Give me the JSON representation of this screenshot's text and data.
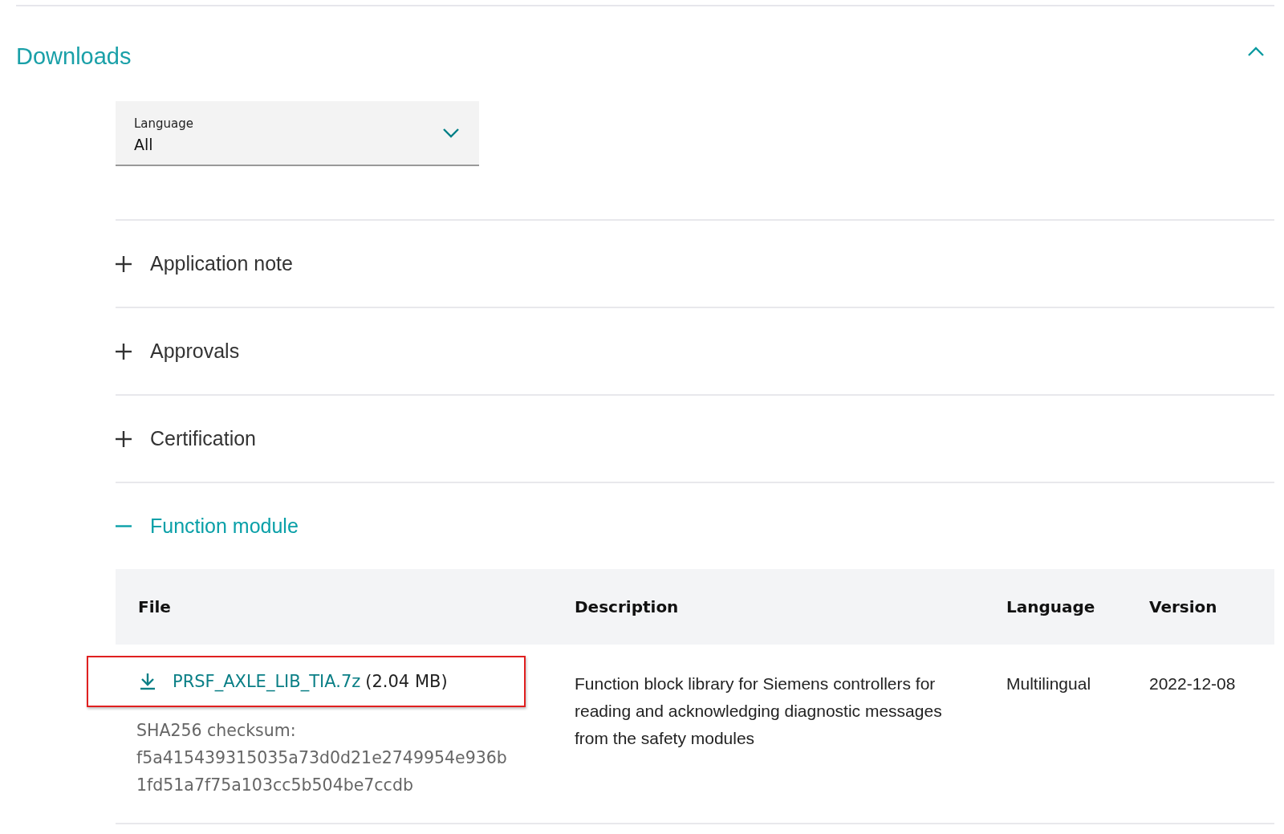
{
  "section": {
    "title": "Downloads",
    "expanded": true
  },
  "language_filter": {
    "label": "Language",
    "value": "All"
  },
  "categories": [
    {
      "label": "Application note",
      "expanded": false
    },
    {
      "label": "Approvals",
      "expanded": false
    },
    {
      "label": "Certification",
      "expanded": false
    },
    {
      "label": "Function module",
      "expanded": true,
      "table": {
        "columns": [
          "File",
          "Description",
          "Language",
          "Version"
        ],
        "rows": [
          {
            "file_name": "PRSF_AXLE_LIB_TIA.7z",
            "file_size": "(2.04 MB)",
            "highlighted": true,
            "checksum_label": "SHA256 checksum:",
            "checksum": "f5a415439315035a73d0d21e2749954e936b 1fd51a7f75a103cc5b504be7ccdb",
            "description": "Function block library for Siemens controllers for reading and acknowledging diagnostic messages from the safety modules",
            "language": "Multilingual",
            "version": "2022-12-08"
          }
        ]
      }
    }
  ]
}
